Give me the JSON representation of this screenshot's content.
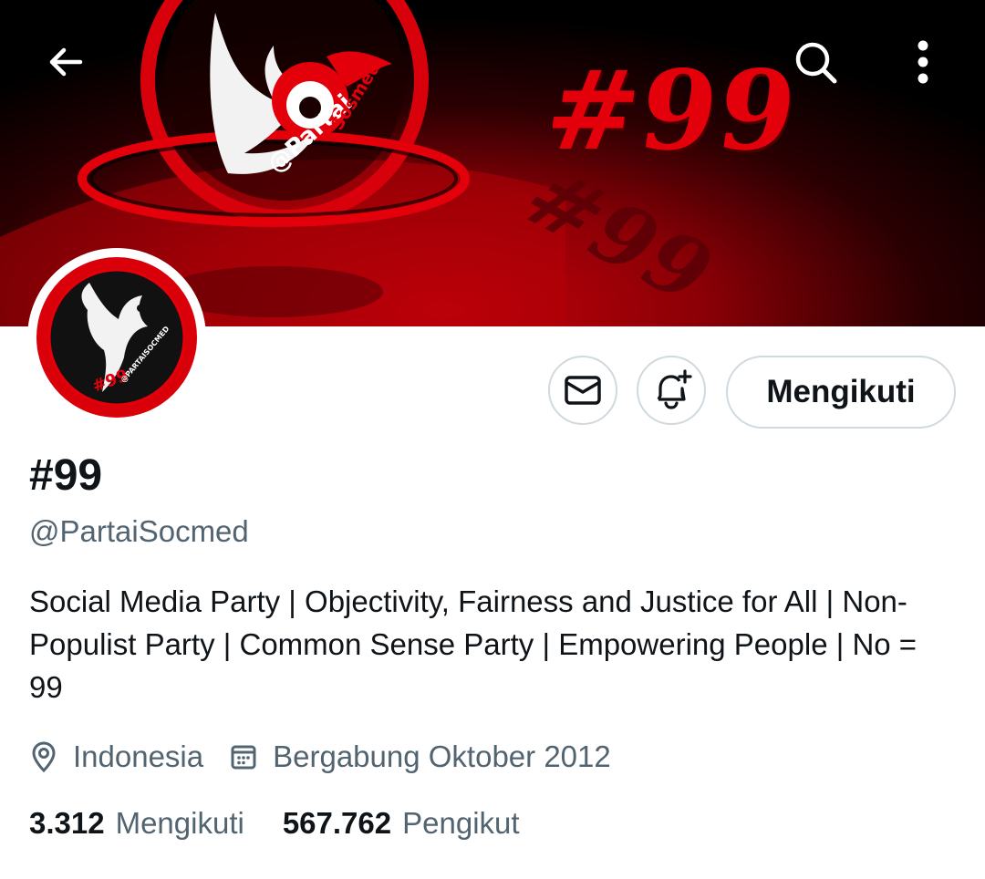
{
  "banner": {
    "tag_text": "#99",
    "tag_reflection": "#99",
    "handle_text": "@Partai",
    "handle_text_2": "Sosmed"
  },
  "header": {
    "back_icon": "arrow-left-icon",
    "search_icon": "search-icon",
    "more_icon": "more-vertical-icon"
  },
  "avatar": {
    "seal_text": "@PARTAISOCMED",
    "seal_number": "#99"
  },
  "actions": {
    "message_icon": "mail-icon",
    "notify_icon": "bell-plus-icon",
    "follow_label": "Mengikuti"
  },
  "profile": {
    "name": "#99",
    "handle": "@PartaiSocmed",
    "bio": "Social Media Party | Objectivity, Fairness and Justice for All | Non-Populist Party | Common Sense Party | Empowering People | No = 99",
    "location": "Indonesia",
    "joined": "Bergabung Oktober 2012"
  },
  "stats": {
    "following_count": "3.312",
    "following_label": "Mengikuti",
    "followers_count": "567.762",
    "followers_label": "Pengikut"
  },
  "colors": {
    "brand_red": "#e3000b",
    "text_primary": "#0f1419",
    "text_secondary": "#536471",
    "border": "#cfd9de"
  }
}
